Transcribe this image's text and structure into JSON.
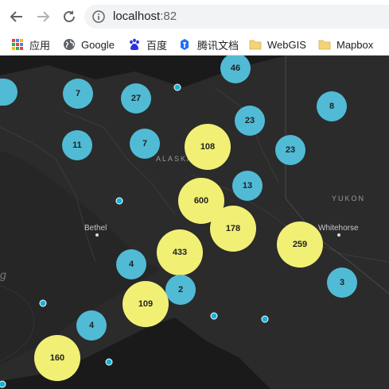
{
  "browser": {
    "url_host": "localhost",
    "url_port": ":82",
    "bookmarks": [
      {
        "label": "应用",
        "icon": "apps-grid-icon"
      },
      {
        "label": "Google",
        "icon": "globe-icon"
      },
      {
        "label": "百度",
        "icon": "baidu-paw-icon"
      },
      {
        "label": "腾讯文档",
        "icon": "tencent-docs-icon"
      },
      {
        "label": "WebGIS",
        "icon": "folder-icon"
      },
      {
        "label": "Mapbox",
        "icon": "folder-icon"
      }
    ]
  },
  "map": {
    "region_labels": {
      "alaska": "ALASKA",
      "yukon": "YUKON"
    },
    "cities": {
      "bethel": "Bethel",
      "whitehorse": "Whitehorse"
    },
    "partial_label": "g",
    "cluster_colors": {
      "small": "#51bbd6",
      "large": "#f1f075",
      "point": "#11b4da"
    },
    "clusters": [
      {
        "count": "46",
        "size": "small"
      },
      {
        "count": "7",
        "size": "small"
      },
      {
        "count": "27",
        "size": "small"
      },
      {
        "count": "8",
        "size": "small"
      },
      {
        "count": "23",
        "size": "small"
      },
      {
        "count": "11",
        "size": "small"
      },
      {
        "count": "7",
        "size": "small"
      },
      {
        "count": "108",
        "size": "large"
      },
      {
        "count": "23",
        "size": "small"
      },
      {
        "count": "13",
        "size": "small"
      },
      {
        "count": "600",
        "size": "large"
      },
      {
        "count": "178",
        "size": "large"
      },
      {
        "count": "259",
        "size": "large"
      },
      {
        "count": "4",
        "size": "small"
      },
      {
        "count": "433",
        "size": "large"
      },
      {
        "count": "2",
        "size": "small"
      },
      {
        "count": "3",
        "size": "small"
      },
      {
        "count": "109",
        "size": "large"
      },
      {
        "count": "4",
        "size": "small"
      },
      {
        "count": "160",
        "size": "large"
      }
    ]
  }
}
